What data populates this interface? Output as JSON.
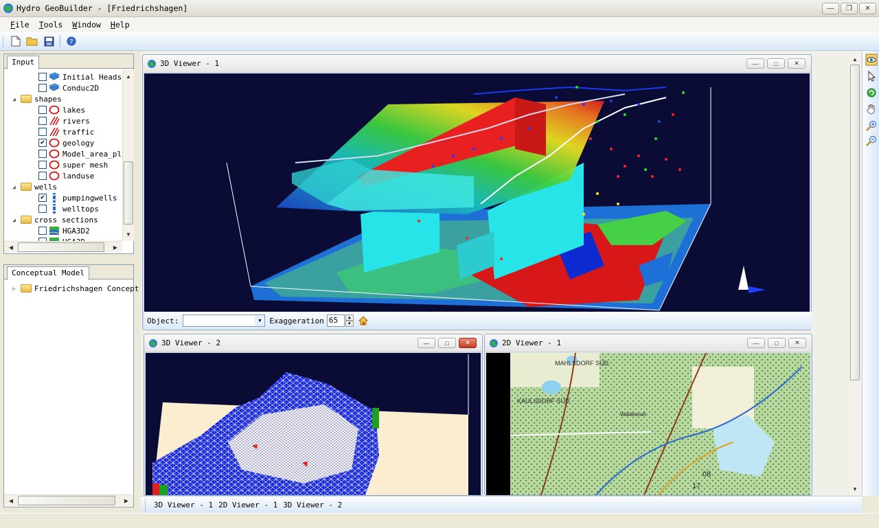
{
  "app": {
    "title": "Hydro GeoBuilder - [Friedrichshagen]"
  },
  "menu": [
    {
      "key": "F",
      "rest": "ile"
    },
    {
      "key": "T",
      "rest": "ools"
    },
    {
      "key": "W",
      "rest": "indow"
    },
    {
      "key": "H",
      "rest": "elp"
    }
  ],
  "input_panel": {
    "tab": "Input",
    "tree": [
      {
        "label": "Initial Heads",
        "level": 2,
        "checked": false,
        "icon": "raster-layer-icon"
      },
      {
        "label": "Conduc2D",
        "level": 2,
        "checked": false,
        "icon": "raster-layer-icon"
      },
      {
        "label": "shapes",
        "level": 1,
        "folder": true
      },
      {
        "label": "lakes",
        "level": 2,
        "checked": false,
        "icon": "shape-layer-icon"
      },
      {
        "label": "rivers",
        "level": 2,
        "checked": false,
        "icon": "line-layer-icon"
      },
      {
        "label": "traffic",
        "level": 2,
        "checked": false,
        "icon": "line-layer-icon"
      },
      {
        "label": "geology",
        "level": 2,
        "checked": true,
        "icon": "shape-layer-icon"
      },
      {
        "label": "Model_area_ply",
        "level": 2,
        "checked": false,
        "icon": "shape-layer-icon"
      },
      {
        "label": "super mesh",
        "level": 2,
        "checked": false,
        "icon": "shape-layer-icon"
      },
      {
        "label": "landuse",
        "level": 2,
        "checked": false,
        "icon": "shape-layer-icon"
      },
      {
        "label": "wells",
        "level": 1,
        "folder": true
      },
      {
        "label": "pumpingwells",
        "level": 2,
        "checked": true,
        "icon": "well-icon"
      },
      {
        "label": "welltops",
        "level": 2,
        "checked": false,
        "icon": "well-icon"
      },
      {
        "label": "cross sections",
        "level": 1,
        "folder": true
      },
      {
        "label": "HGA3D2",
        "level": 2,
        "checked": false,
        "icon": "cross-section-icon"
      },
      {
        "label": "HGA3D",
        "level": 2,
        "checked": false,
        "icon": "cross-section-icon"
      }
    ]
  },
  "concept_panel": {
    "tab": "Conceptual Model",
    "root": "Friedrichshagen Concept"
  },
  "viewers": {
    "v1": {
      "title": "3D Viewer - 1"
    },
    "v2": {
      "title": "3D Viewer - 2"
    },
    "v3": {
      "title": "2D Viewer - 1"
    }
  },
  "object_bar": {
    "object_label": "Object:",
    "object_value": "",
    "exaggeration_label": "Exaggeration",
    "exaggeration_value": "65"
  },
  "map_labels": {
    "mahlsdorf": "MAHLSDORF SÜD",
    "kaulsdorf": "KAULSDORF SÜD",
    "waldesruh": "Waldesruh",
    "number_08": "08",
    "number_17": "17"
  },
  "window_list": [
    "3D Viewer - 1",
    "2D Viewer - 1",
    "3D Viewer - 2"
  ],
  "colors": {
    "accent": "#1c5180",
    "viewer_bg": "#0a0c36",
    "mdi_title": "#d4e3f4"
  }
}
